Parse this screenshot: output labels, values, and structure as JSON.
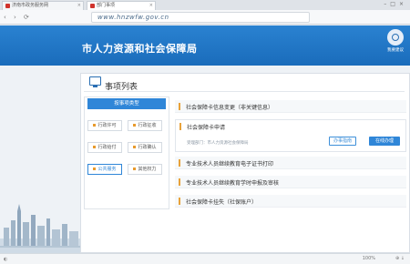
{
  "browser": {
    "tabs": [
      {
        "label": "济南市政务服务网"
      },
      {
        "label": "部门事项"
      }
    ],
    "url": "www.hnzwfw.gov.cn",
    "zoom": "100%"
  },
  "header": {
    "title": "市人力资源和社会保障局",
    "feedback_label": "我要建议"
  },
  "panel": {
    "title": "事项列表"
  },
  "categories": {
    "header": "按事项类型",
    "items": [
      {
        "label": "行政许可"
      },
      {
        "label": "行政征收"
      },
      {
        "label": "行政给付"
      },
      {
        "label": "行政确认"
      },
      {
        "label": "公共服务"
      },
      {
        "label": "其他权力"
      }
    ]
  },
  "items": [
    {
      "label": "社会保障卡信息变更（非关键信息）"
    },
    {
      "label": "社会保障卡申请",
      "sub": "受理部门：市人力资源社会保障局",
      "guide_label": "办事指南",
      "apply_label": "在线办理"
    },
    {
      "label": "专业技术人员继续教育电子证书打印"
    },
    {
      "label": "专业技术人员继续教育学时申报及审核"
    },
    {
      "label": "社会保障卡挂失（社保账户）"
    }
  ],
  "colors": {
    "brand_blue": "#1d72c2",
    "accent_orange": "#e8a23a"
  }
}
